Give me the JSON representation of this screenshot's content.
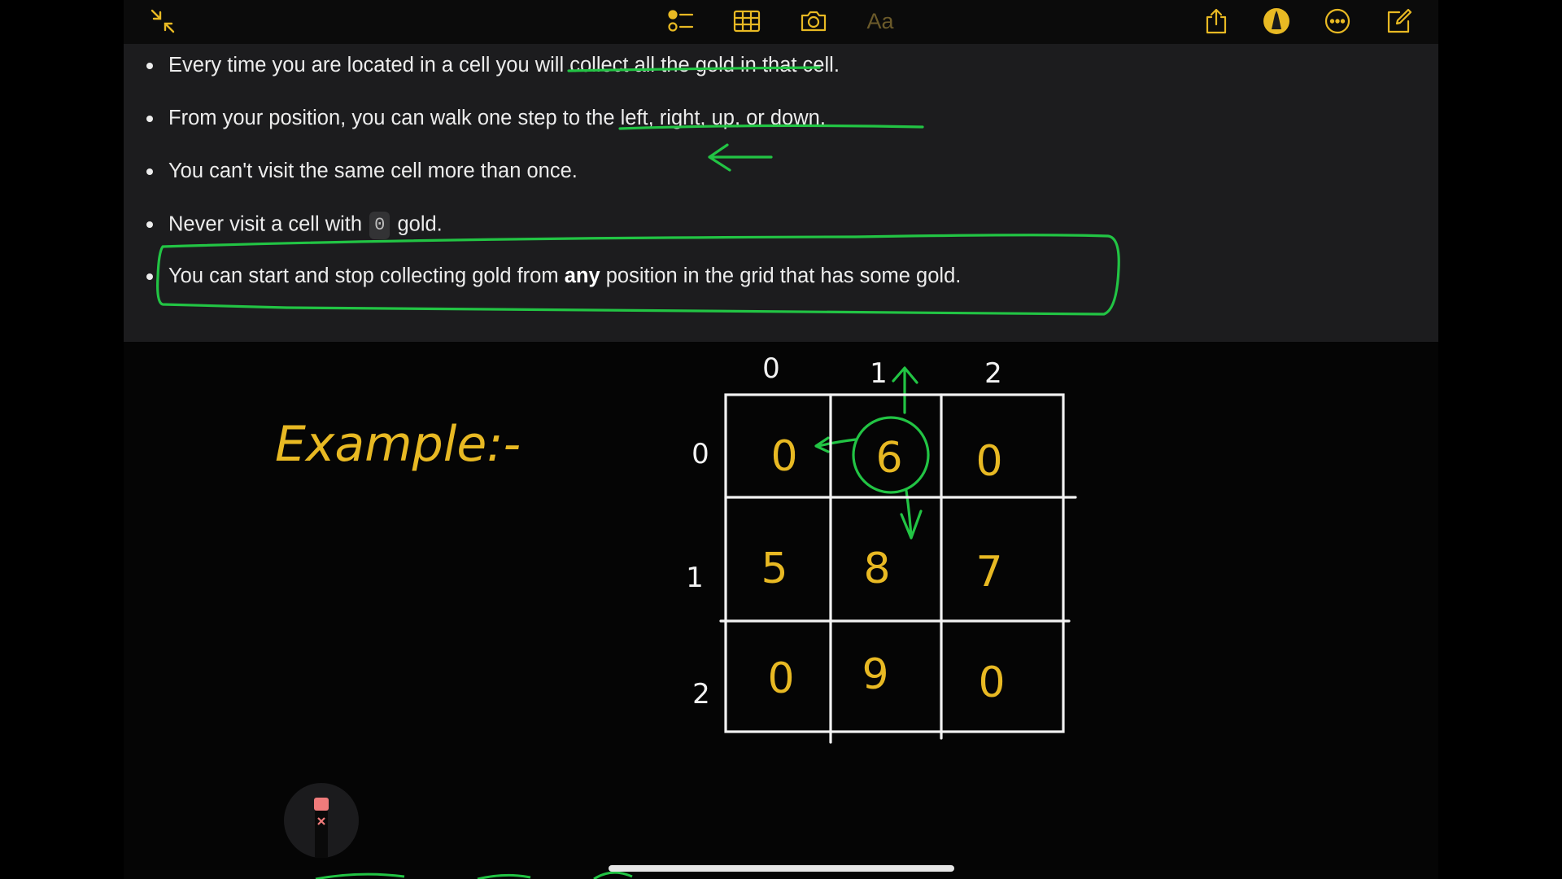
{
  "toolbar": {
    "icons": [
      "collapse-icon",
      "checklist-icon",
      "table-icon",
      "camera-icon",
      "text-format-icon",
      "share-icon",
      "markup-pen-icon",
      "more-icon",
      "compose-icon"
    ],
    "text_format_label": "Aa"
  },
  "notes": {
    "bullet1": "Every time you are located in a cell you will collect all the gold in that cell.",
    "bullet2": "From your position, you can walk one step to the left, right, up, or down.",
    "bullet3": "You can't visit the same cell more than once.",
    "bullet4_prefix": "Never visit a cell with",
    "bullet4_code": "0",
    "bullet4_suffix": "gold.",
    "bullet5_prefix": "You can start and stop collecting gold from",
    "bullet5_bold": "any",
    "bullet5_suffix": "position in the grid that has some gold."
  },
  "drawing": {
    "example_label": "Example:-",
    "col_indices": [
      "0",
      "1",
      "2"
    ],
    "row_indices": [
      "0",
      "1",
      "2"
    ],
    "grid": [
      [
        "0",
        "6",
        "0"
      ],
      [
        "5",
        "8",
        "7"
      ],
      [
        "0",
        "9",
        "0"
      ]
    ],
    "ink_colors": {
      "green": "#22c444",
      "yellow": "#e8b923",
      "white": "#f2f2f2"
    }
  }
}
